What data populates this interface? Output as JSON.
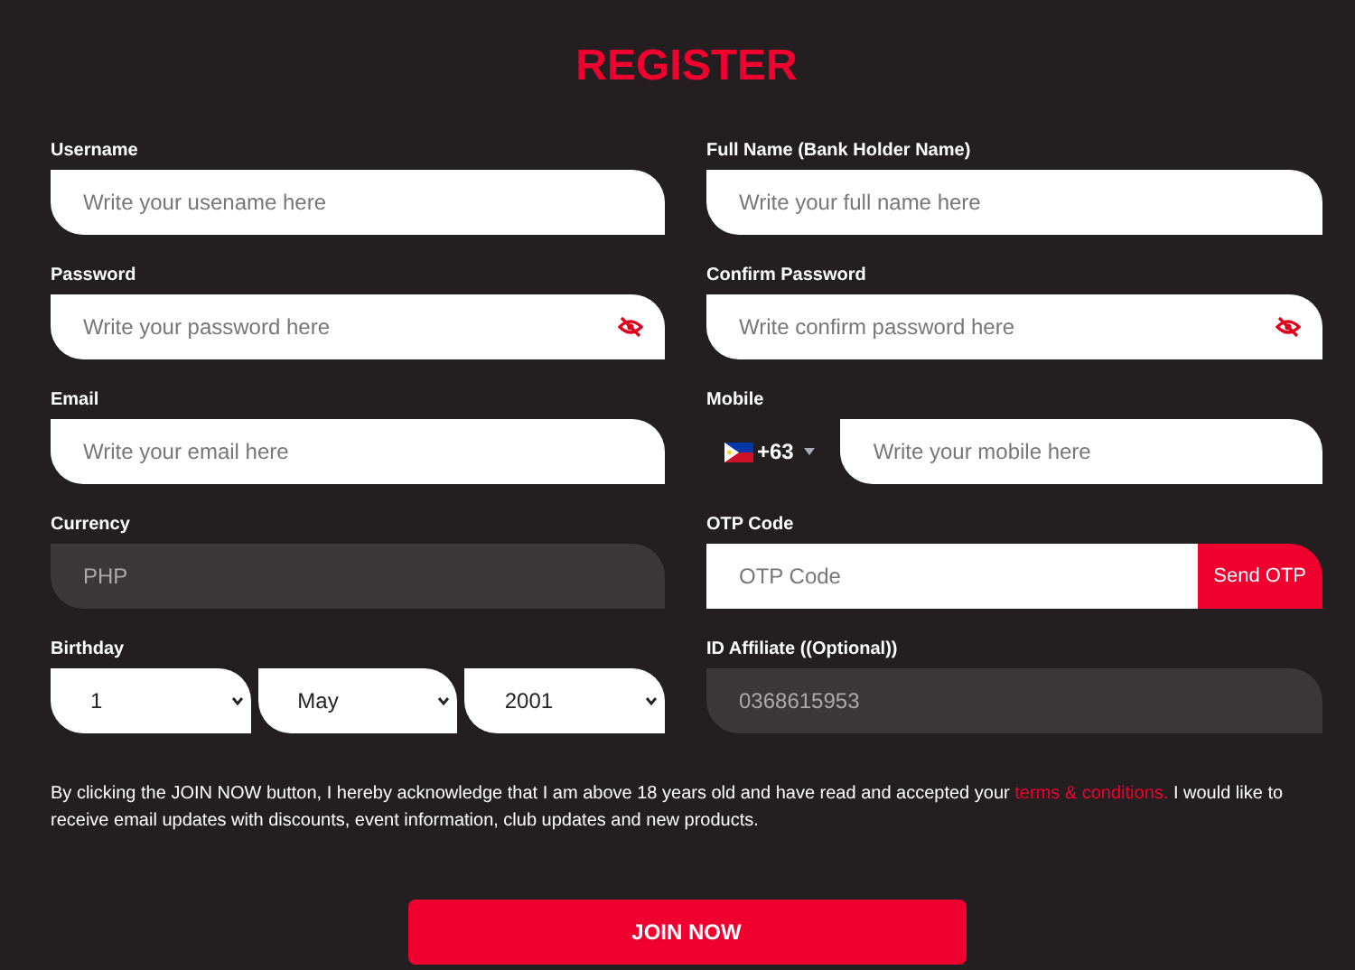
{
  "title": "REGISTER",
  "fields": [
    {
      "label": "Username",
      "kind": "text",
      "placeholder": "Write your usename here"
    },
    {
      "label": "Full Name (Bank Holder Name)",
      "kind": "text",
      "placeholder": "Write your full name here"
    },
    {
      "label": "Password",
      "kind": "password",
      "placeholder": "Write your password here"
    },
    {
      "label": "Confirm Password",
      "kind": "password",
      "placeholder": "Write confirm password here"
    },
    {
      "label": "Email",
      "kind": "text",
      "placeholder": "Write your email here"
    },
    {
      "label": "Mobile",
      "kind": "mobile",
      "country_code": "+63",
      "placeholder": "Write your mobile here"
    },
    {
      "label": "Currency",
      "kind": "text",
      "value": "PHP",
      "disabled": true
    },
    {
      "label": "OTP Code",
      "kind": "otp",
      "placeholder": "OTP Code",
      "button": "Send OTP"
    },
    {
      "label": "Birthday",
      "kind": "date",
      "parts": [
        "1",
        "May",
        "2001"
      ]
    },
    {
      "label": "ID Affiliate ((Optional))",
      "kind": "text",
      "value": "0368615953",
      "disabled": true
    }
  ],
  "consent": {
    "before": "By clicking the JOIN NOW button, I hereby acknowledge that I am above 18 years old and have read and accepted your ",
    "link": "terms & conditions.",
    "after": " I would like to receive email updates with discounts, event information, club updates and new products."
  },
  "submit": "JOIN NOW"
}
